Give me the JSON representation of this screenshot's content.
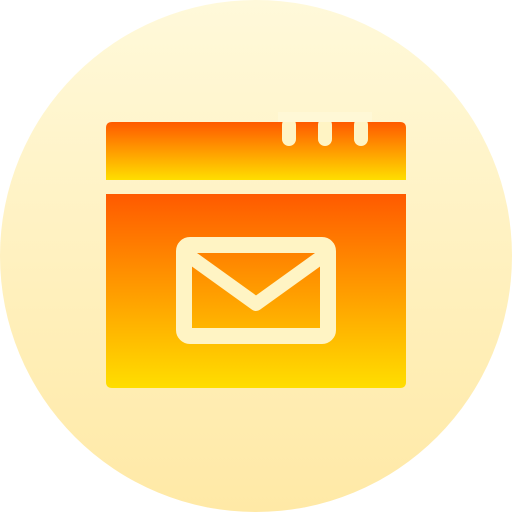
{
  "icon": {
    "name": "browser-mail-icon",
    "description_free": true
  },
  "colors": {
    "background_circle_top": "#FFF9DA",
    "background_circle_bottom": "#FFE9A6",
    "window_top": "#FF5A00",
    "window_bottom": "#FFDE00",
    "cutout": "#FFF4C4"
  }
}
